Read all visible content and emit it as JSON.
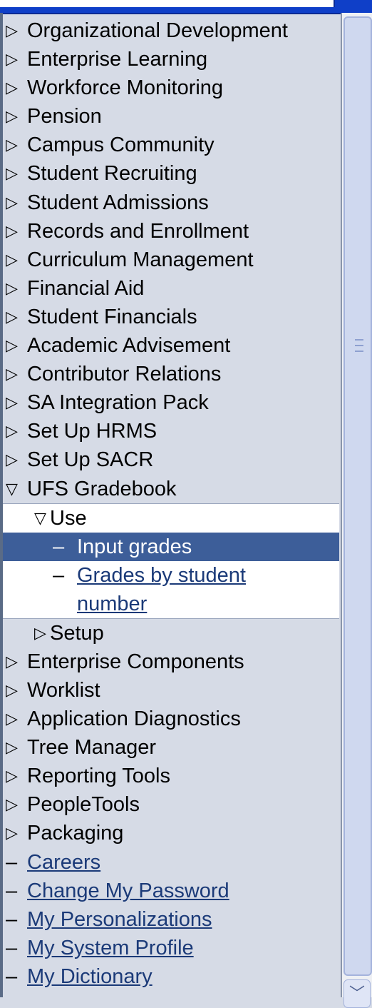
{
  "menu": {
    "top_items": [
      {
        "label": "Organizational Development",
        "state": "collapsed"
      },
      {
        "label": "Enterprise Learning",
        "state": "collapsed"
      },
      {
        "label": "Workforce Monitoring",
        "state": "collapsed"
      },
      {
        "label": "Pension",
        "state": "collapsed"
      },
      {
        "label": "Campus Community",
        "state": "collapsed"
      },
      {
        "label": "Student Recruiting",
        "state": "collapsed"
      },
      {
        "label": "Student Admissions",
        "state": "collapsed"
      },
      {
        "label": "Records and Enrollment",
        "state": "collapsed"
      },
      {
        "label": "Curriculum Management",
        "state": "collapsed"
      },
      {
        "label": "Financial Aid",
        "state": "collapsed"
      },
      {
        "label": "Student Financials",
        "state": "collapsed"
      },
      {
        "label": "Academic Advisement",
        "state": "collapsed"
      },
      {
        "label": "Contributor Relations",
        "state": "collapsed"
      },
      {
        "label": "SA Integration Pack",
        "state": "collapsed"
      },
      {
        "label": "Set Up HRMS",
        "state": "collapsed"
      },
      {
        "label": "Set Up SACR",
        "state": "collapsed"
      }
    ],
    "expanded": {
      "label": "UFS Gradebook",
      "use": {
        "label": "Use",
        "children": [
          {
            "label": "Input grades",
            "selected": true
          },
          {
            "label": "Grades by student number",
            "selected": false
          }
        ]
      },
      "setup": {
        "label": "Setup"
      }
    },
    "bottom_items": [
      {
        "label": "Enterprise Components"
      },
      {
        "label": "Worklist"
      },
      {
        "label": "Application Diagnostics"
      },
      {
        "label": "Tree Manager"
      },
      {
        "label": "Reporting Tools"
      },
      {
        "label": "PeopleTools"
      },
      {
        "label": "Packaging"
      }
    ],
    "links": [
      {
        "label": "Careers"
      },
      {
        "label": "Change My Password"
      },
      {
        "label": "My Personalizations"
      },
      {
        "label": "My System Profile"
      },
      {
        "label": "My Dictionary"
      }
    ]
  },
  "icons": {
    "collapsed": "triangle-right-outline",
    "expanded": "triangle-down-outline",
    "leaf": "dash",
    "scroll_down": "chevron-down"
  },
  "colors": {
    "background": "#d6dbe6",
    "selected": "#3d5e99",
    "link": "#1b3a78",
    "title_bar": "#0f3fc8"
  }
}
